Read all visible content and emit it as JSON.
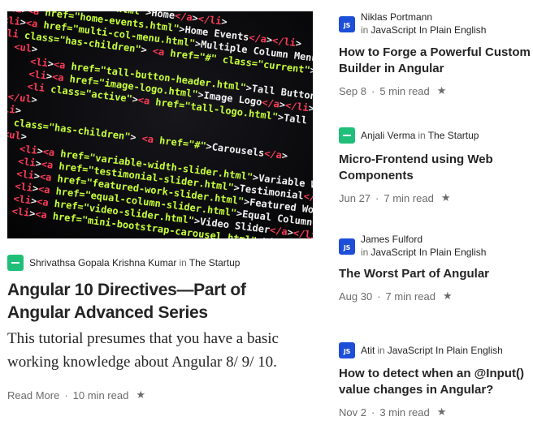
{
  "featured": {
    "image": {
      "description_icon": "code-screenshot",
      "code_lines": [
        "<li><a href=\"index.html\">Home</a></li>",
        "<li><a href=\"home-events.html\">Home Events</a></li>",
        "<li><a href=\"multi-col-menu.html\">Multiple Column Menu</a></li>",
        "<li class=\"has-children\"> <a href=\"#\" class=\"current\">Header</a>",
        "<ul>",
        "<li><a href=\"tall-button-header.html\">Tall Button Header</a></li>",
        "<li><a href=\"image-logo.html\">Image Logo</a></li>",
        "<li class=\"active\"><a href=\"tall-logo.html\">Tall Logo</a></li>",
        "</ul>",
        "</li>",
        "<li class=\"has-children\"> <a href=\"#\">Carousels</a>",
        "<ul>",
        "<li><a href=\"variable-width-slider.html\">Variable Width</a></li>",
        "<li><a href=\"testimonial-slider.html\">Testimonial</a></li>",
        "<li><a href=\"featured-work-slider.html\">Featured Work</a></li>",
        "<li><a href=\"equal-column-slider.html\">Equal Column</a></li>",
        "<li><a href=\"video-slider.html\">Video Slider</a></li>",
        "<li><a href=\"mini-bootstrap-carousel.html\">Mini</a></li>"
      ]
    },
    "author": "Shrivathsa Gopala Krishna Kumar",
    "in_label": "in",
    "publication": "The Startup",
    "title": "Angular 10 Directives—Part of Angular Advanced Series",
    "subtitle": "This tutorial presumes that you have a basic working knowledge about Angular 8/ 9/ 10.",
    "read_more": "Read More",
    "separator": "·",
    "read_time": "10 min read",
    "star": "★"
  },
  "list": [
    {
      "author": "Niklas Portmann",
      "in_label": "in",
      "publication": "JavaScript In Plain English",
      "pub_icon": "JS",
      "title": "How to Forge a Powerful Custom Builder in Angular",
      "date": "Sep 8",
      "separator": "·",
      "read_time": "5 min read",
      "star": "★"
    },
    {
      "author": "Anjali Verma",
      "in_label": "in",
      "publication": "The Startup",
      "pub_icon": "",
      "title": "Micro-Frontend using Web Components",
      "date": "Jun 27",
      "separator": "·",
      "read_time": "7 min read",
      "star": "★"
    },
    {
      "author": "James Fulford",
      "in_label": "in",
      "publication": "JavaScript In Plain English",
      "pub_icon": "JS",
      "title": "The Worst Part of Angular",
      "date": "Aug 30",
      "separator": "·",
      "read_time": "7 min read",
      "star": "★"
    },
    {
      "author": "Atit",
      "in_label": "in",
      "publication": "JavaScript In Plain English",
      "pub_icon": "JS",
      "title": "How to detect when an @Input() value changes in Angular?",
      "date": "Nov 2",
      "separator": "·",
      "read_time": "3 min read",
      "star": "★"
    }
  ],
  "colors": {
    "text": "#242424",
    "muted": "#6b6b6b",
    "js_badge": "#1d4ed8",
    "startup_badge": "#1fbf7a",
    "code_green": "#c8ff3a",
    "code_red": "#ff3b57",
    "code_white": "#f2f2f2"
  }
}
